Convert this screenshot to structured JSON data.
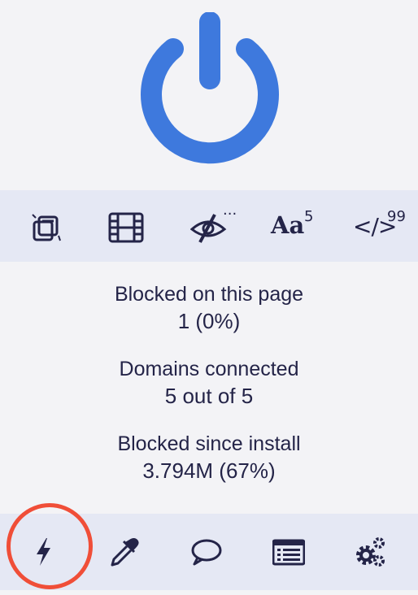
{
  "power": {
    "icon": "power-icon",
    "color": "#3e79dd"
  },
  "toolbar": {
    "popups": {
      "icon": "popup-windows-icon"
    },
    "media": {
      "icon": "film-strip-icon"
    },
    "cosmetic": {
      "icon": "eye-slash-icon",
      "badge": "..."
    },
    "fonts": {
      "label": "Aa",
      "badge": "5"
    },
    "scripts": {
      "label": "</>",
      "badge": "99"
    }
  },
  "stats": {
    "blocked_page_label": "Blocked on this page",
    "blocked_page_value": "1 (0%)",
    "domains_label": "Domains connected",
    "domains_value": "5 out of 5",
    "blocked_install_label": "Blocked since install",
    "blocked_install_value": "3.794M (67%)"
  },
  "bottom": {
    "zapper": {
      "icon": "lightning-bolt-icon"
    },
    "picker": {
      "icon": "eyedropper-icon"
    },
    "report": {
      "icon": "speech-bubble-icon"
    },
    "logger": {
      "icon": "list-window-icon"
    },
    "dashboard": {
      "icon": "gears-icon"
    }
  },
  "highlight_color": "#f04e38",
  "icon_color": "#242448"
}
